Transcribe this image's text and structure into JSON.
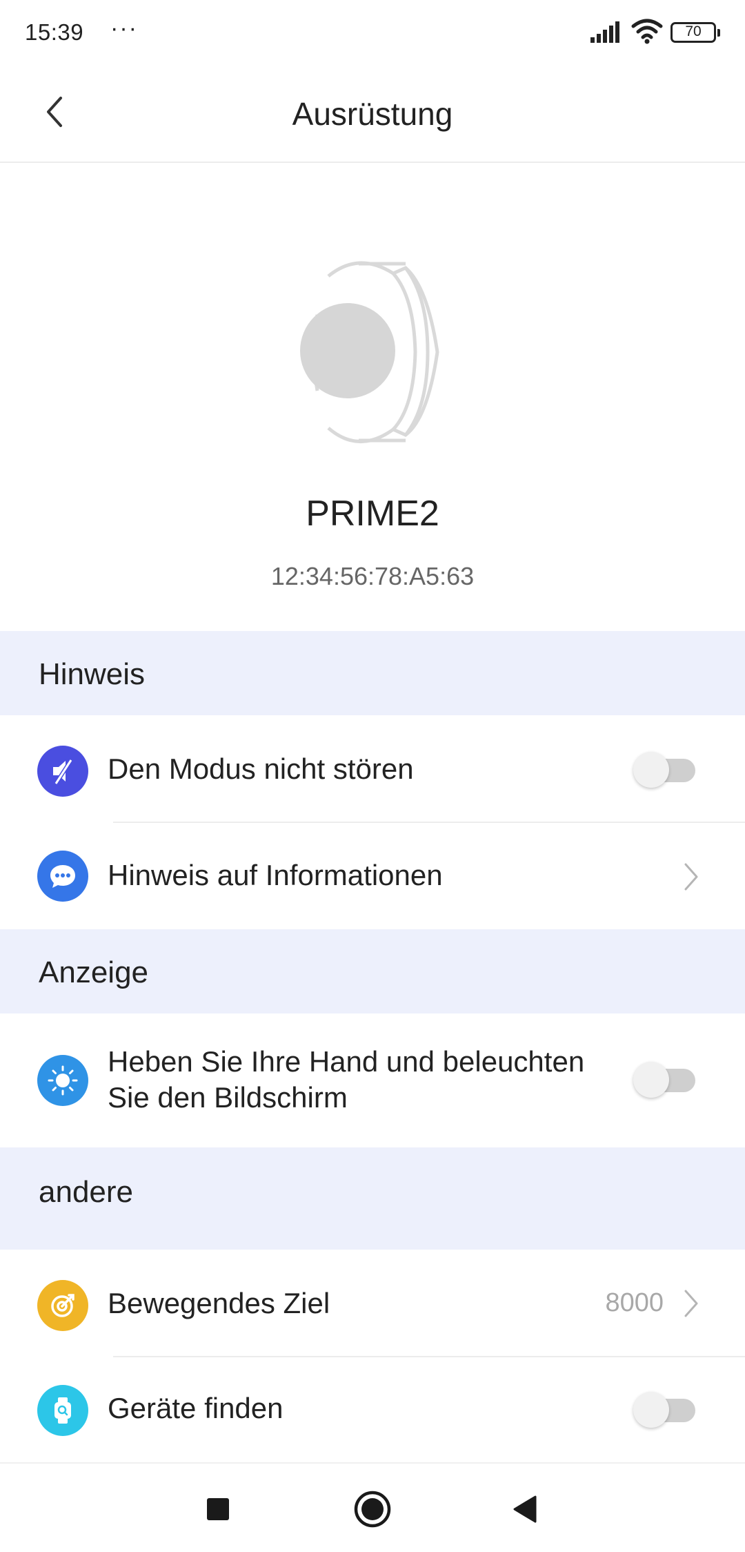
{
  "status_bar": {
    "time": "15:39",
    "more": "···",
    "battery": "70",
    "signal_icon": "signal-icon",
    "wifi_icon": "wifi-icon"
  },
  "header": {
    "title": "Ausrüstung",
    "back_icon": "back-chevron-icon"
  },
  "device": {
    "name": "PRIME2",
    "mac": "12:34:56:78:A5:63",
    "image_icon": "smartwatch-icon"
  },
  "sections": {
    "hinweis": {
      "title": "Hinweis",
      "items": [
        {
          "label": "Den Modus nicht stören",
          "icon": "mute-icon",
          "icon_color": "#4a4ee0",
          "control": "toggle",
          "on": false
        },
        {
          "label": "Hinweis auf Informationen",
          "icon": "message-icon",
          "icon_color": "#3576e8",
          "control": "chevron"
        }
      ]
    },
    "anzeige": {
      "title": "Anzeige",
      "items": [
        {
          "label_line1": "Heben Sie Ihre Hand und beleuchten",
          "label_line2": "Sie den Bildschirm",
          "icon": "brightness-icon",
          "icon_color": "#2f93e6",
          "control": "toggle",
          "on": false
        }
      ]
    },
    "andere": {
      "title": "andere",
      "items": [
        {
          "label": "Bewegendes Ziel",
          "icon": "target-icon",
          "icon_color": "#f0b527",
          "control": "chevron",
          "value": "8000"
        },
        {
          "label": "Geräte finden",
          "icon": "find-watch-icon",
          "icon_color": "#2cc6e8",
          "control": "toggle",
          "on": false
        }
      ]
    }
  },
  "nav": {
    "recents_icon": "recents-square-icon",
    "home_icon": "home-circle-icon",
    "back_icon": "back-triangle-icon"
  },
  "colors": {
    "section_bg": "#edf0fc",
    "divider": "#ececec",
    "toggle_off_track": "#cfcfcf"
  }
}
